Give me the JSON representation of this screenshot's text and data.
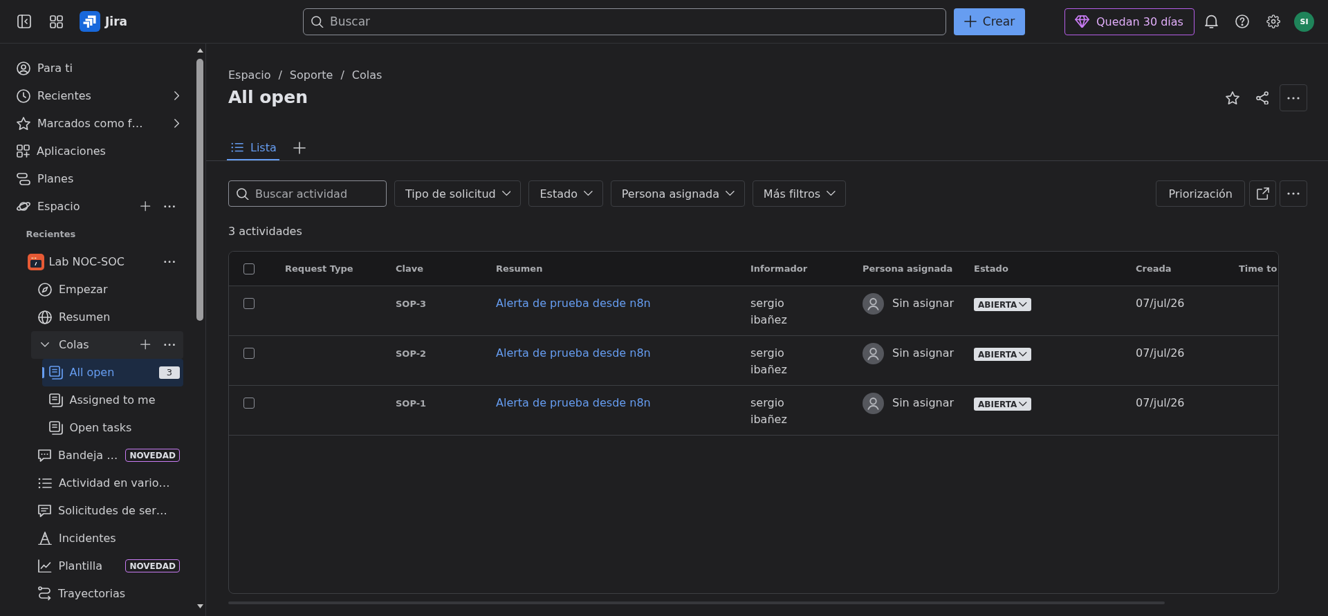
{
  "topbar": {
    "product_name": "Jira",
    "search": {
      "placeholder": "Buscar"
    },
    "create_button": "Crear",
    "trial_button": "Quedan 30 días",
    "avatar_initials": "SI"
  },
  "sidebar": {
    "items": [
      {
        "label": "Para ti",
        "selected": false
      },
      {
        "label": "Recientes",
        "selected": false,
        "submenu": true
      },
      {
        "label": "Marcados como f…",
        "selected": false,
        "submenu": true
      },
      {
        "label": "Aplicaciones",
        "selected": false
      },
      {
        "label": "Planes",
        "selected": false
      },
      {
        "label": "Espacio",
        "selected": false,
        "add_button": true,
        "more_button": true,
        "children": [
          {
            "kind": "heading",
            "label": "Recientes"
          },
          {
            "kind": "project",
            "label": "Lab NOC-SOC",
            "selected": false,
            "more_button": true,
            "children": [
              {
                "label": "Empezar",
                "selected": false,
                "hovered": false
              },
              {
                "label": "Resumen",
                "selected": false,
                "hovered": false
              },
              {
                "label": "Colas",
                "selected": false,
                "hovered": true,
                "expanded": true,
                "add_button": true,
                "more_button": true,
                "children": [
                  {
                    "label": "All open",
                    "selected": true,
                    "count": "3"
                  },
                  {
                    "label": "Assigned to me",
                    "selected": false
                  },
                  {
                    "label": "Open tasks",
                    "selected": false
                  }
                ]
              },
              {
                "label": "Bandeja …",
                "selected": false,
                "hovered": false,
                "badge": "NOVEDAD"
              },
              {
                "label": "Actividad en vario…",
                "selected": false,
                "hovered": false
              },
              {
                "label": "Solicitudes de ser…",
                "selected": false,
                "hovered": false
              },
              {
                "label": "Incidentes",
                "selected": false,
                "hovered": false
              },
              {
                "label": "Plantilla",
                "selected": false,
                "hovered": false,
                "badge": "NOVEDAD"
              },
              {
                "label": "Trayectorias",
                "selected": false,
                "hovered": false
              }
            ]
          }
        ]
      }
    ]
  },
  "page": {
    "breadcrumbs": [
      {
        "kind": "link",
        "text": "Espacio"
      },
      {
        "kind": "separator",
        "text": "/"
      },
      {
        "kind": "link",
        "text": "Soporte"
      },
      {
        "kind": "separator",
        "text": "/"
      },
      {
        "kind": "link",
        "text": "Colas"
      }
    ],
    "title": "All open",
    "tabs": [
      {
        "label": "Lista",
        "selected": true
      }
    ]
  },
  "filters": {
    "search": {
      "placeholder": "Buscar actividad"
    },
    "dropdowns": [
      "Tipo de solicitud",
      "Estado",
      "Persona asignada",
      "Más filtros"
    ],
    "priority_button": "Priorización"
  },
  "result_count": "3 actividades",
  "table": {
    "select_all_checked": false,
    "columns": [
      "Request Type",
      "Clave",
      "Resumen",
      "Informador",
      "Persona asignada",
      "Estado",
      "Creada",
      "Time to"
    ],
    "rows": [
      {
        "checked": false,
        "key": "SOP-3",
        "summary": "Alerta de prueba desde n8n",
        "reporter": "sergio ibañez",
        "assignee": "Sin asignar",
        "status": "ABIERTA",
        "created": "07/jul/26"
      },
      {
        "checked": false,
        "key": "SOP-2",
        "summary": "Alerta de prueba desde n8n",
        "reporter": "sergio ibañez",
        "assignee": "Sin asignar",
        "status": "ABIERTA",
        "created": "07/jul/26"
      },
      {
        "checked": false,
        "key": "SOP-1",
        "summary": "Alerta de prueba desde n8n",
        "reporter": "sergio ibañez",
        "assignee": "Sin asignar",
        "status": "ABIERTA",
        "created": "07/jul/26"
      }
    ]
  }
}
